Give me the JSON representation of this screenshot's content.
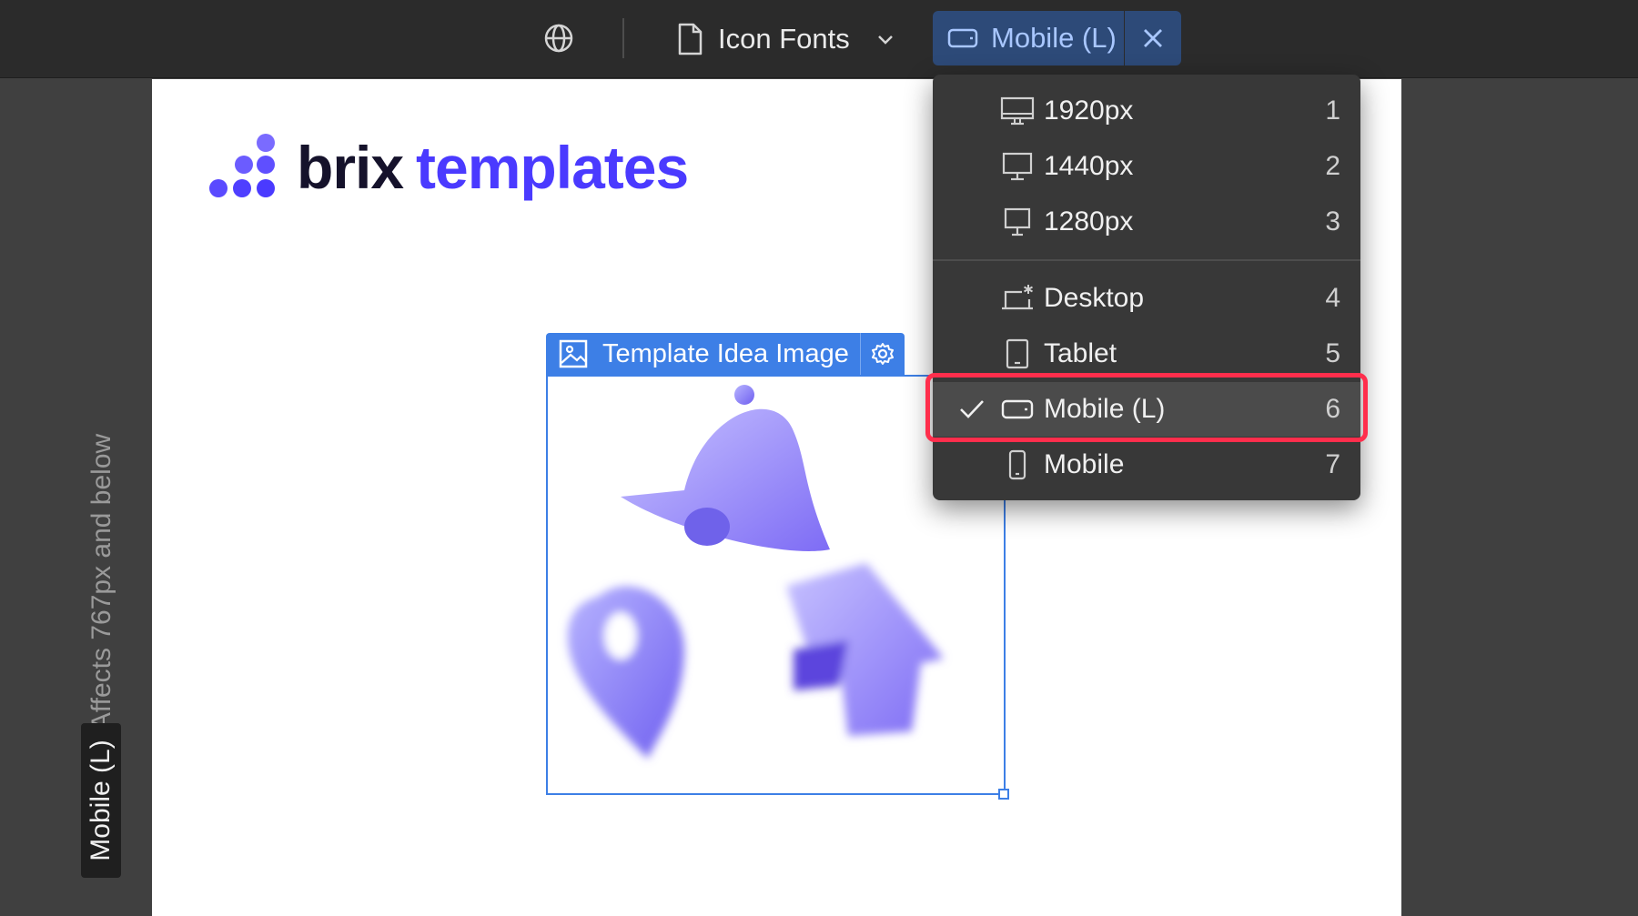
{
  "topbar": {
    "page_name": "Icon Fonts",
    "breakpoint_label": "Mobile (L)",
    "icons": [
      "globe-icon",
      "page-icon",
      "chevron-down-icon",
      "mobile-landscape-icon",
      "close-icon"
    ]
  },
  "left_rail": {
    "affects_text": "Affects 767px and below",
    "breakpoint_badge": "Mobile (L)"
  },
  "canvas": {
    "logo": {
      "word1": "brix",
      "word2": "templates"
    },
    "selected_element": {
      "label": "Template Idea Image",
      "icons": [
        "image-icon",
        "gear-icon"
      ]
    }
  },
  "breakpoint_menu": {
    "items": [
      {
        "label": "1920px",
        "key": "1",
        "icon": "monitor-icon"
      },
      {
        "label": "1440px",
        "key": "2",
        "icon": "monitor-icon"
      },
      {
        "label": "1280px",
        "key": "3",
        "icon": "monitor-icon"
      },
      {
        "label": "Desktop",
        "key": "4",
        "icon": "desktop-base-icon"
      },
      {
        "label": "Tablet",
        "key": "5",
        "icon": "tablet-icon"
      },
      {
        "label": "Mobile (L)",
        "key": "6",
        "icon": "mobile-landscape-icon",
        "selected": true
      },
      {
        "label": "Mobile",
        "key": "7",
        "icon": "mobile-portrait-icon"
      }
    ]
  },
  "colors": {
    "accent_blue": "#3d7fe6",
    "brand_purple": "#4a3aff",
    "highlight_red": "#ff2e4c"
  }
}
